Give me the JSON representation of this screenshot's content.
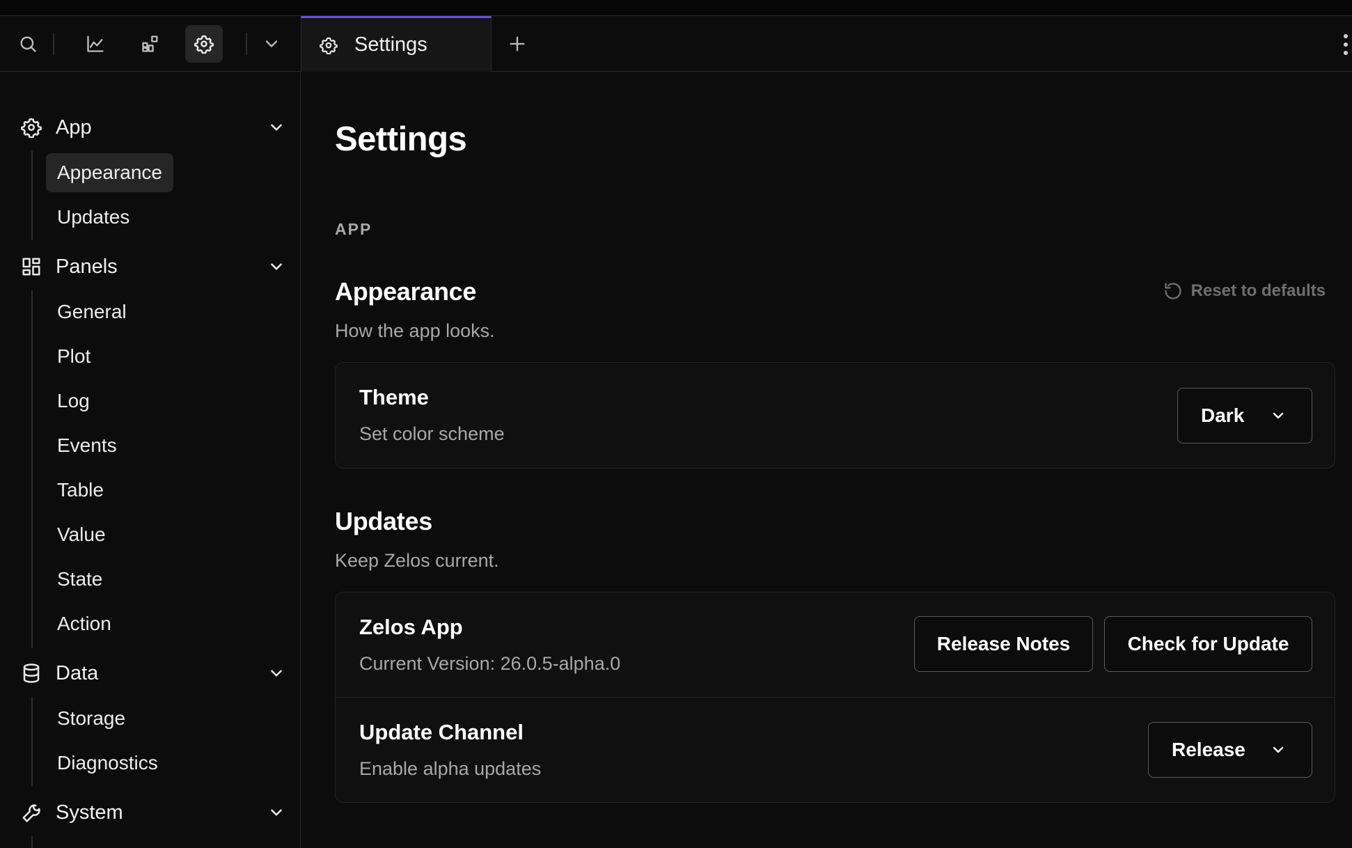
{
  "toolbar": {
    "icons": [
      "search-icon",
      "line-chart-icon",
      "panels-add-icon",
      "gear-icon",
      "chevron-down-icon"
    ],
    "active_icon": "gear-icon",
    "tab": {
      "label": "Settings",
      "icon": "gear-icon"
    },
    "new_tab_icon": "plus-icon",
    "more_icon": "kebab-icon"
  },
  "sidebar": {
    "groups": [
      {
        "label": "App",
        "icon": "gear-icon",
        "items": [
          "Appearance",
          "Updates"
        ]
      },
      {
        "label": "Panels",
        "icon": "panels-icon",
        "items": [
          "General",
          "Plot",
          "Log",
          "Events",
          "Table",
          "Value",
          "State",
          "Action"
        ]
      },
      {
        "label": "Data",
        "icon": "database-icon",
        "items": [
          "Storage",
          "Diagnostics"
        ]
      },
      {
        "label": "System",
        "icon": "wrench-icon",
        "items": []
      }
    ],
    "selected_item": "Appearance"
  },
  "main": {
    "title": "Settings",
    "section_label": "APP",
    "appearance": {
      "title": "Appearance",
      "description": "How the app looks.",
      "reset_label": "Reset to defaults",
      "theme": {
        "title": "Theme",
        "subtitle": "Set color scheme",
        "value": "Dark"
      }
    },
    "updates": {
      "title": "Updates",
      "description": "Keep Zelos current.",
      "app": {
        "title": "Zelos App",
        "version": "Current Version: 26.0.5-alpha.0",
        "release_notes_label": "Release Notes",
        "check_update_label": "Check for Update"
      },
      "channel": {
        "title": "Update Channel",
        "subtitle": "Enable alpha updates",
        "value": "Release"
      }
    }
  },
  "colors": {
    "background": "#0c0c0c",
    "accent": "#6c4ee6",
    "muted_text": "#a8a8a8"
  }
}
